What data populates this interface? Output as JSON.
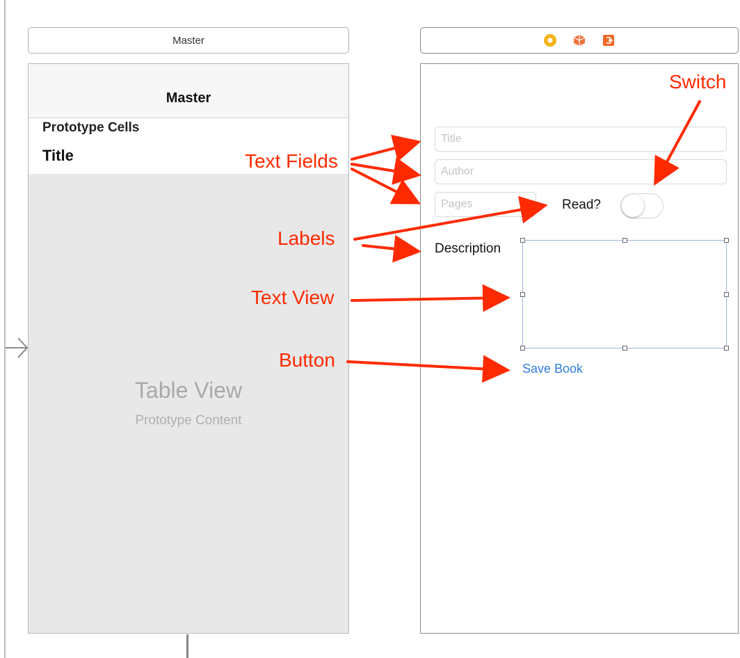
{
  "master_scene": {
    "bar_title": "Master",
    "nav_title": "Master",
    "section_header": "Prototype Cells",
    "cell_title": "Title",
    "table_view_title": "Table View",
    "table_view_subtitle": "Prototype Content"
  },
  "detail_scene": {
    "bar_icons": [
      "view-controller-icon",
      "first-responder-icon",
      "exit-icon"
    ],
    "fields": {
      "title_placeholder": "Title",
      "author_placeholder": "Author",
      "pages_placeholder": "Pages"
    },
    "read_label": "Read?",
    "description_label": "Description",
    "switch_on": false,
    "save_button": "Save Book"
  },
  "annotations": {
    "switch": "Switch",
    "text_fields": "Text Fields",
    "labels": "Labels",
    "text_view": "Text View",
    "button": "Button"
  },
  "colors": {
    "annotation": "#ff2a00",
    "button_tint": "#2f7fe0",
    "placeholder": "#c4c4c4",
    "table_bg": "#e8e8e8"
  }
}
